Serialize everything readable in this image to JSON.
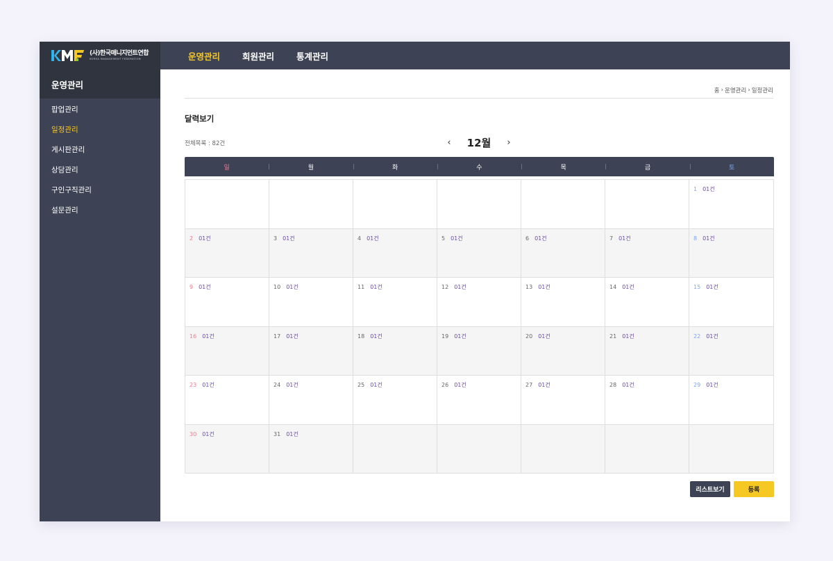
{
  "logo": {
    "name": "(사)한국매니지먼트연합",
    "sub": "KOREA MANAGEMENT FEDERATION",
    "mark_colors": [
      "#2fb3e8",
      "#f6c823",
      "#8fc640"
    ]
  },
  "topnav": {
    "items": [
      {
        "label": "운영관리",
        "active": true
      },
      {
        "label": "회원관리",
        "active": false
      },
      {
        "label": "통계관리",
        "active": false
      }
    ]
  },
  "sidebar": {
    "header": "운영관리",
    "items": [
      {
        "label": "팝업관리",
        "active": false
      },
      {
        "label": "일정관리",
        "active": true
      },
      {
        "label": "게시판관리",
        "active": false
      },
      {
        "label": "상담관리",
        "active": false
      },
      {
        "label": "구인구직관리",
        "active": false
      },
      {
        "label": "설문관리",
        "active": false
      }
    ]
  },
  "breadcrumb": {
    "home": "홈",
    "section": "운영관리",
    "current": "일정관리"
  },
  "page": {
    "title": "달력보기",
    "count": "전체목록 : 82건"
  },
  "calendar": {
    "month": "12월",
    "prev_icon": "‹",
    "next_icon": "›",
    "weekdays": [
      "일",
      "월",
      "화",
      "수",
      "목",
      "금",
      "토"
    ],
    "weeks": [
      [
        null,
        null,
        null,
        null,
        null,
        null,
        {
          "day": "1",
          "count": "01건"
        }
      ],
      [
        {
          "day": "2",
          "count": "01건"
        },
        {
          "day": "3",
          "count": "01건"
        },
        {
          "day": "4",
          "count": "01건"
        },
        {
          "day": "5",
          "count": "01건"
        },
        {
          "day": "6",
          "count": "01건"
        },
        {
          "day": "7",
          "count": "01건"
        },
        {
          "day": "8",
          "count": "01건"
        }
      ],
      [
        {
          "day": "9",
          "count": "01건"
        },
        {
          "day": "10",
          "count": "01건"
        },
        {
          "day": "11",
          "count": "01건"
        },
        {
          "day": "12",
          "count": "01건"
        },
        {
          "day": "13",
          "count": "01건"
        },
        {
          "day": "14",
          "count": "01건"
        },
        {
          "day": "15",
          "count": "01건"
        }
      ],
      [
        {
          "day": "16",
          "count": "01건"
        },
        {
          "day": "17",
          "count": "01건"
        },
        {
          "day": "18",
          "count": "01건"
        },
        {
          "day": "19",
          "count": "01건"
        },
        {
          "day": "20",
          "count": "01건"
        },
        {
          "day": "21",
          "count": "01건"
        },
        {
          "day": "22",
          "count": "01건"
        }
      ],
      [
        {
          "day": "23",
          "count": "01건"
        },
        {
          "day": "24",
          "count": "01건"
        },
        {
          "day": "25",
          "count": "01건"
        },
        {
          "day": "26",
          "count": "01건"
        },
        {
          "day": "27",
          "count": "01건"
        },
        {
          "day": "28",
          "count": "01건"
        },
        {
          "day": "29",
          "count": "01건"
        }
      ],
      [
        {
          "day": "30",
          "count": "01건"
        },
        {
          "day": "31",
          "count": "01건"
        },
        null,
        null,
        null,
        null,
        null
      ]
    ]
  },
  "buttons": {
    "list": "리스트보기",
    "register": "등록"
  },
  "colors": {
    "dark": "#3d4254",
    "darker": "#30343f",
    "accent": "#f6c823",
    "sunday": "#f3798f",
    "saturday": "#7aa6f4",
    "count": "#6a4ba4"
  }
}
